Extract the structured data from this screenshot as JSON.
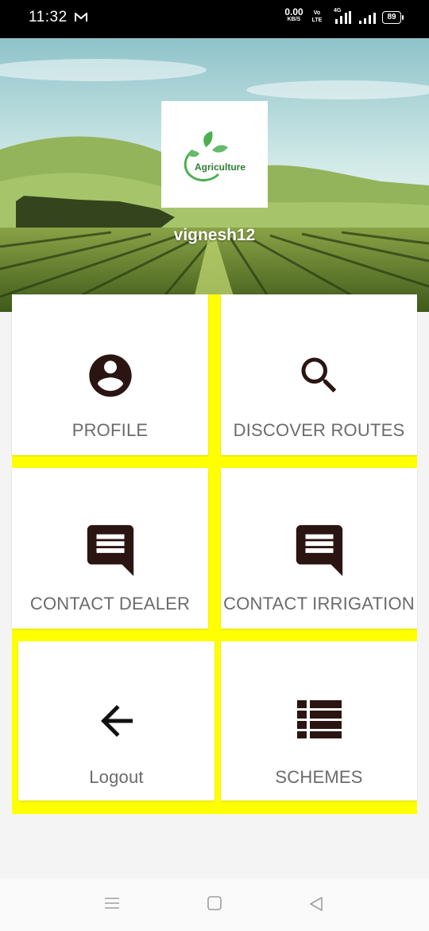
{
  "status_bar": {
    "time": "11:32",
    "net_speed_value": "0.00",
    "net_speed_unit": "KB/S",
    "volte": "Vo LTE",
    "network": "4G",
    "battery": "89"
  },
  "header": {
    "logo_text": "Agriculture",
    "username": "vignesh12"
  },
  "tiles": [
    {
      "label": "PROFILE",
      "icon": "account-circle-icon"
    },
    {
      "label": "DISCOVER ROUTES",
      "icon": "search-icon"
    },
    {
      "label": "CONTACT DEALER",
      "icon": "message-icon"
    },
    {
      "label": "CONTACT IRRIGATION",
      "icon": "message-icon"
    },
    {
      "label": "Logout",
      "icon": "arrow-back-icon"
    },
    {
      "label": "SCHEMES",
      "icon": "list-icon"
    }
  ],
  "colors": {
    "grid_background": "#ffff00",
    "icon_color": "#2b1512",
    "label_color": "#6b6b6b"
  }
}
